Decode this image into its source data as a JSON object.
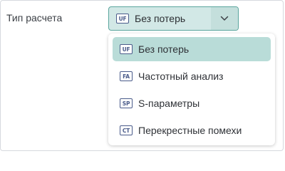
{
  "field": {
    "label": "Тип расчета",
    "selected": {
      "icon": "UF",
      "label": "Без потерь"
    }
  },
  "menu": {
    "items": [
      {
        "icon": "UF",
        "label": "Без потерь",
        "selected": true
      },
      {
        "icon": "FA",
        "label": "Частотный анализ",
        "selected": false
      },
      {
        "icon": "SP",
        "label": "S-параметры",
        "selected": false
      },
      {
        "icon": "CT",
        "label": "Перекрестные помехи",
        "selected": false
      }
    ]
  },
  "colors": {
    "accent_border": "#5aa59d",
    "selected_bg": "#b9dcd8",
    "badge": "#4a5b8a"
  }
}
